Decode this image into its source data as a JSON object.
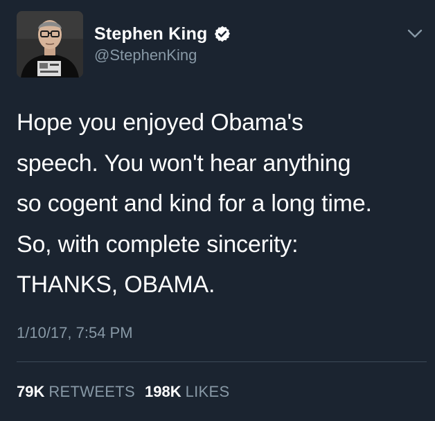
{
  "author": {
    "display_name": "Stephen King",
    "handle": "@StephenKing",
    "verified": true,
    "avatar_icon": "profile-photo"
  },
  "tweet": {
    "text": "Hope you enjoyed Obama's\nspeech. You won't hear anything\nso cogent and kind for a long time.\nSo, with complete sincerity:\nTHANKS, OBAMA.",
    "timestamp": "1/10/17, 7:54 PM"
  },
  "stats": {
    "retweets_count": "79K",
    "retweets_label": "RETWEETS",
    "likes_count": "198K",
    "likes_label": "LIKES"
  },
  "colors": {
    "background": "#1b2430",
    "primary_text": "#ffffff",
    "secondary_text": "#8899a6",
    "divider": "#3d4a58"
  },
  "icons": {
    "verified": "verified-badge-icon",
    "more": "chevron-down-icon"
  }
}
